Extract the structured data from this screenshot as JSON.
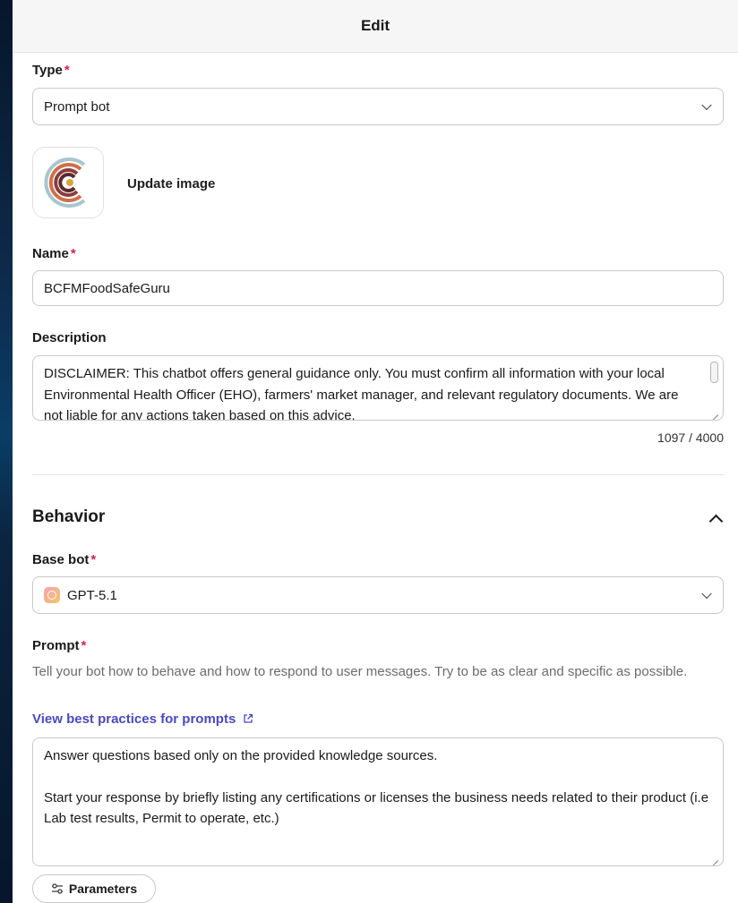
{
  "header": {
    "title": "Edit"
  },
  "type_field": {
    "label": "Type",
    "required_mark": "*",
    "value": "Prompt bot"
  },
  "image": {
    "update_label": "Update image",
    "logo_colors": [
      "#a8c6cf",
      "#cf6f4a",
      "#8e3b3b",
      "#5a2a2e",
      "#d9a441"
    ]
  },
  "name_field": {
    "label": "Name",
    "required_mark": "*",
    "value": "BCFMFoodSafeGuru"
  },
  "description": {
    "label": "Description",
    "value": "DISCLAIMER: This chatbot offers general guidance only. You must confirm all information with your local Environmental Health Officer (EHO), farmers' market manager, and relevant regulatory documents. We are not liable for any actions taken based on this advice.",
    "counter": "1097 / 4000"
  },
  "behavior": {
    "title": "Behavior"
  },
  "base_bot": {
    "label": "Base bot",
    "required_mark": "*",
    "value": "GPT-5.1",
    "icon": "gpt-icon"
  },
  "prompt": {
    "label": "Prompt",
    "required_mark": "*",
    "help": "Tell your bot how to behave and how to respond to user messages. Try to be as clear and specific as possible.",
    "link": "View best practices for prompts",
    "line1": "Answer questions based only on the provided knowledge sources.",
    "line2": "Start your response by briefly listing any certifications or licenses the business needs related to their product (i.e Lab test results, Permit to operate, etc.)"
  },
  "parameters_button": {
    "label": "Parameters",
    "icon": "sliders-icon"
  },
  "colors": {
    "accent_link": "#4b48c4",
    "required": "#d1264b",
    "border": "#c9c9cd"
  }
}
